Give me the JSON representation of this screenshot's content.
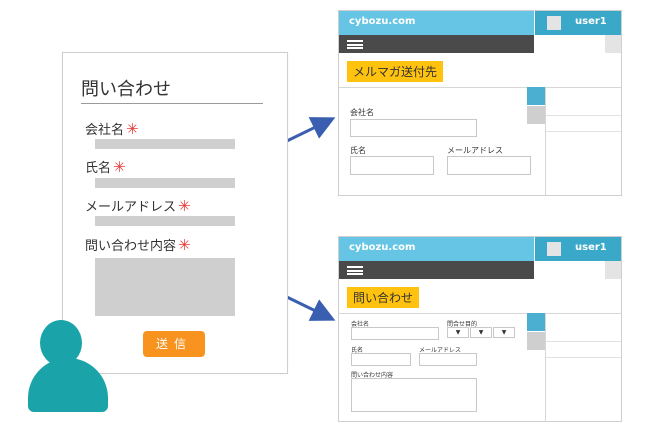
{
  "form": {
    "title": "問い合わせ",
    "fields": [
      {
        "label": "会社名",
        "required": "✳"
      },
      {
        "label": "氏名",
        "required": "✳"
      },
      {
        "label": "メールアドレス",
        "required": "✳"
      },
      {
        "label": "問い合わせ内容",
        "required": "✳"
      }
    ],
    "submit_label": "送信"
  },
  "screens": [
    {
      "url": "cybozu.com",
      "user": "user1",
      "heading": "メルマガ送付先",
      "labels": [
        "会社名",
        "氏名",
        "メールアドレス"
      ]
    },
    {
      "url": "cybozu.com",
      "user": "user1",
      "heading": "問い合わせ",
      "labels": [
        "会社名",
        "問合せ目的",
        "氏名",
        "メールアドレス",
        "問い合わせ内容"
      ],
      "select_glyph": "▼"
    }
  ],
  "colors": {
    "header": "#66c5e4",
    "user_bar": "#3aa8c9",
    "heading_highlight": "#ffc20e",
    "submit": "#f7931e",
    "required": "#e53935",
    "arrow": "#3a5fb0",
    "person": "#1aa3a8"
  },
  "icons": [
    "person-icon",
    "menu-icon",
    "arrow-icon"
  ]
}
